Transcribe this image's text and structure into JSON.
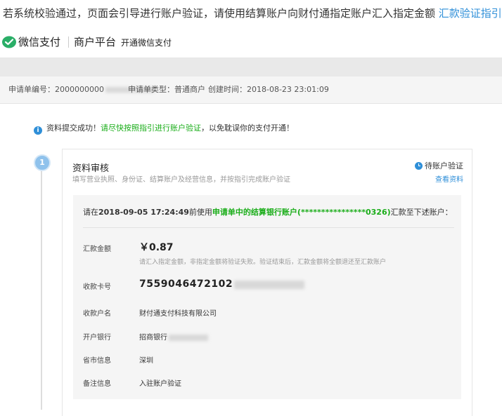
{
  "intro": {
    "text": "若系统校验通过，页面会引导进行账户验证，请使用结算账户向财付通指定账户汇入指定金额",
    "link": "汇款验证指引"
  },
  "header": {
    "brand": "微信支付",
    "platform": "商户平台",
    "open_link": "开通微信支付"
  },
  "application": {
    "id_label": "申请单编号：",
    "id_value": "2000000000",
    "type_label": "申请单类型：",
    "type_value": "普通商户",
    "created_label": "创建时间：",
    "created_value": "2018-08-23 23:01:09"
  },
  "notice": {
    "prefix": "资料提交成功！",
    "link": "请尽快按照指引进行账户验证",
    "suffix": "，以免耽误你的支付开通！"
  },
  "step": {
    "number": "1",
    "title": "资料审核",
    "subtitle": "填写营业执照、身份证、结算账户及经营信息，并按指引完成账户验证",
    "status": "待账户验证",
    "view_link": "查看资料"
  },
  "transfer": {
    "prefix": "请在",
    "deadline": "2018-09-05 17:24:49",
    "mid": "前使用",
    "account_text": "申请单中的结算银行账户(****************0326)",
    "suffix": "汇款至下述账户："
  },
  "details": {
    "amount_label": "汇款金额",
    "amount_value": "￥0.87",
    "amount_note": "请汇入指定金额，非指定金额将验证失败。验证结束后，汇款金额将全额退还至汇款账户",
    "card_label": "收款卡号",
    "card_value": "7559046472102",
    "name_label": "收款户名",
    "name_value": "财付通支付科技有限公司",
    "bank_label": "开户银行",
    "bank_value": "招商银行",
    "region_label": "省市信息",
    "region_value": "深圳",
    "remark_label": "备注信息",
    "remark_value": "入驻账户验证"
  },
  "colors": {
    "accent": "#2f8fd8",
    "green": "#1aad19",
    "wechat_green": "#2aae67"
  }
}
